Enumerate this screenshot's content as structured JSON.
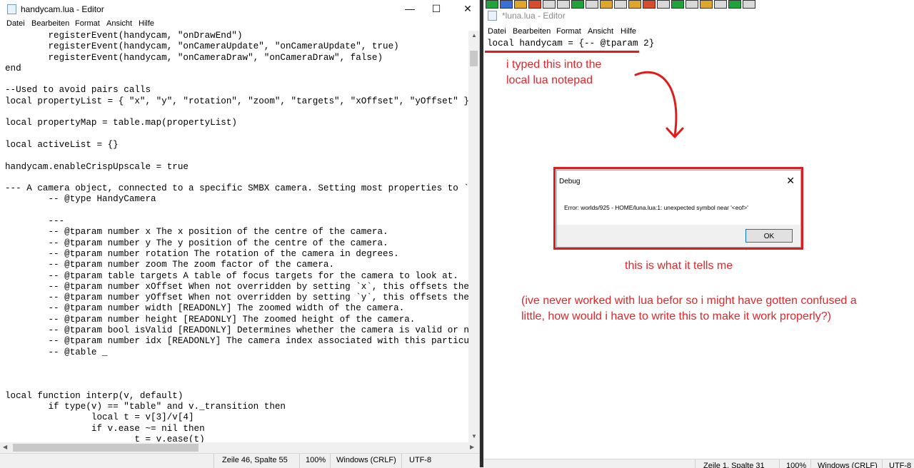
{
  "left_window": {
    "title": "handycam.lua - Editor",
    "controls": {
      "minimize": "—",
      "maximize": "☐",
      "close": "✕"
    },
    "menu": [
      "Datei",
      "Bearbeiten",
      "Format",
      "Ansicht",
      "Hilfe"
    ],
    "code": "        registerEvent(handycam, \"onDrawEnd\")\n        registerEvent(handycam, \"onCameraUpdate\", \"onCameraUpdate\", true)\n        registerEvent(handycam, \"onCameraDraw\", \"onCameraDraw\", false)\nend\n\n--Used to avoid pairs calls\nlocal propertyList = { \"x\", \"y\", \"rotation\", \"zoom\", \"targets\", \"xOffset\", \"yOffset\" }\n\nlocal propertyMap = table.map(propertyList)\n\nlocal activeList = {}\n\nhandycam.enableCrispUpscale = true\n\n--- A camera object, connected to a specific SMBX camera. Setting most properties to `nil` will\n        -- @type HandyCamera\n\n        ---\n        -- @tparam number x The x position of the centre of the camera.\n        -- @tparam number y The y position of the centre of the camera.\n        -- @tparam number rotation The rotation of the camera in degrees.\n        -- @tparam number zoom The zoom factor of the camera.\n        -- @tparam table targets A table of focus targets for the camera to look at.\n        -- @tparam number xOffset When not overridden by setting `x`, this offsets the camera f\n        -- @tparam number yOffset When not overridden by setting `y`, this offsets the camera f\n        -- @tparam number width [READONLY] The zoomed width of the camera.\n        -- @tparam number height [READONLY] The zoomed height of the camera.\n        -- @tparam bool isValid [READONLY] Determines whether the camera is valid or not (`Hand\n        -- @tparam number idx [READONLY] The camera index associated with this particular `Hand\n        -- @table _\n\n\n\nlocal function interp(v, default)\n        if type(v) == \"table\" and v._transition then\n                local t = v[3]/v[4]\n                if v.ease ~= nil then\n                        t = v.ease(t)",
    "status": {
      "position": "Zeile 46, Spalte 55",
      "zoom": "100%",
      "line_endings": "Windows (CRLF)",
      "encoding": "UTF-8"
    }
  },
  "right_window": {
    "title": "*luna.lua - Editor",
    "menu": [
      "Datei",
      "Bearbeiten",
      "Format",
      "Ansicht",
      "Hilfe"
    ],
    "code": "local handycam = {-- @tparam 2}",
    "status": {
      "position": "Zeile 1, Spalte 31",
      "zoom": "100%",
      "line_endings": "Windows (CRLF)",
      "encoding": "UTF-8"
    }
  },
  "annotations": {
    "typed_note": [
      "i typed this into the",
      "local lua notepad"
    ],
    "tells_note": "this is what it tells me",
    "question_note": [
      "(ive never worked with lua befor so i might have gotten confused a",
      "little, how would i have to write this to make it work properly?)"
    ]
  },
  "dialog": {
    "title": "Debug",
    "close": "✕",
    "message": "Error: worlds/925 - HOME/luna.lua:1: unexpected symbol near '<eof>'",
    "ok_label": "OK"
  },
  "colors": {
    "annotation_red": "#e01b1b",
    "status_gray": "#f0f0f0"
  }
}
